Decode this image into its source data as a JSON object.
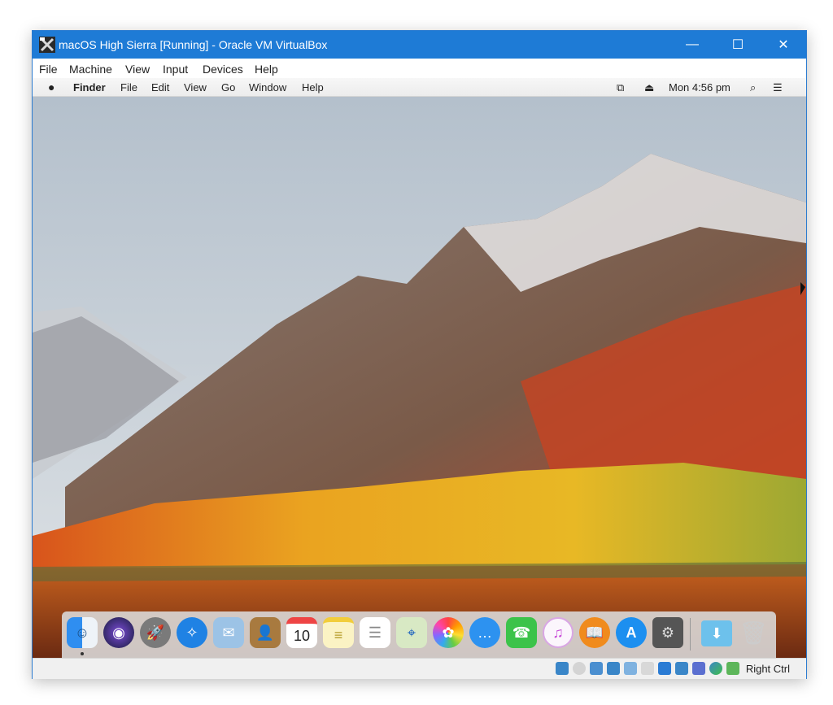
{
  "window": {
    "title": "macOS High Sierra [Running] - Oracle VM VirtualBox",
    "controls": {
      "minimize": "—",
      "maximize": "☐",
      "close": "✕"
    }
  },
  "vbox_menu": [
    "File",
    "Machine",
    "View",
    "Input",
    "Devices",
    "Help"
  ],
  "mac_menubar": {
    "apple": "",
    "app": "Finder",
    "items": [
      "File",
      "Edit",
      "View",
      "Go",
      "Window",
      "Help"
    ],
    "clock": "Mon 4:56 pm",
    "icons": [
      "display-mirroring-icon",
      "eject-icon",
      "spotlight-search-icon",
      "notification-center-icon"
    ]
  },
  "dock": {
    "apps": [
      {
        "name": "finder",
        "glyph": "☺",
        "color": "#2f8ef0"
      },
      {
        "name": "siri",
        "glyph": "◉",
        "color": "#4a2e8f"
      },
      {
        "name": "launchpad",
        "glyph": "🚀",
        "color": "#7a7a7a"
      },
      {
        "name": "safari",
        "glyph": "✧",
        "color": "#1f82e4"
      },
      {
        "name": "mail",
        "glyph": "✉",
        "color": "#6aa8de"
      },
      {
        "name": "contacts",
        "glyph": "👤",
        "color": "#a87a3f"
      },
      {
        "name": "calendar",
        "glyph": "10",
        "color": "#ffffff"
      },
      {
        "name": "notes",
        "glyph": "≡",
        "color": "#f6e27a"
      },
      {
        "name": "reminders",
        "glyph": "☰",
        "color": "#ffffff"
      },
      {
        "name": "maps",
        "glyph": "⌖",
        "color": "#8ccf74"
      },
      {
        "name": "photos",
        "glyph": "✿",
        "color": "#ffffff"
      },
      {
        "name": "messages",
        "glyph": "…",
        "color": "#2d92f0"
      },
      {
        "name": "facetime",
        "glyph": "☎",
        "color": "#3cc34a"
      },
      {
        "name": "itunes",
        "glyph": "♫",
        "color": "#f3e9f7"
      },
      {
        "name": "ibooks",
        "glyph": "📖",
        "color": "#f08b1d"
      },
      {
        "name": "app-store",
        "glyph": "A",
        "color": "#1c8ff0"
      },
      {
        "name": "system-preferences",
        "glyph": "⚙",
        "color": "#555555"
      }
    ],
    "folders": [
      {
        "name": "downloads",
        "glyph": "⬇",
        "color": "#6dc1ec"
      },
      {
        "name": "trash",
        "glyph": "🗑",
        "color": "#e8e8e8"
      }
    ]
  },
  "statusbar": {
    "icons": [
      "hard-disk-icon",
      "optical-drive-icon",
      "audio-icon",
      "network-icon",
      "usb-icon",
      "shared-folders-icon",
      "display-icon",
      "video-capture-icon",
      "cpu-icon",
      "mouse-integration-icon",
      "keyboard-capture-icon"
    ],
    "host_key": "Right Ctrl"
  }
}
